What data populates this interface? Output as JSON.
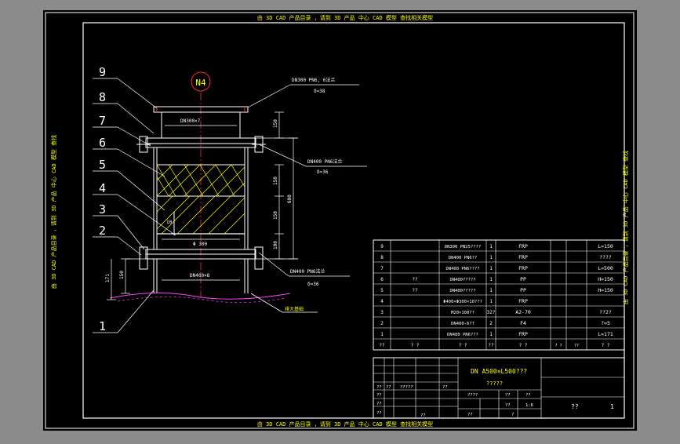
{
  "banners": {
    "top": "由 3D CAD 产品目录 ，请到 3D 产品 中心 CAD 模型 查找相关模型",
    "bottom": "由 3D CAD 产品目录 ，请到 3D 产品 中心 CAD 模型 查找相关模型",
    "left": "由 3D CAD 产品目录 ，请到 3D 产品 中心 CAD 模型 查找",
    "right": "由 3D CAD 产品目录 ，请到 3D 产品 中心 CAD 模型 查找"
  },
  "drawing": {
    "nozzle_tag": "N4",
    "balloons": [
      "9",
      "8",
      "7",
      "6",
      "5",
      "4",
      "3",
      "2",
      "1"
    ],
    "annotations": {
      "top_flange": "DN300 PN6, 6法兰",
      "top_flange_thk": "δ=38",
      "mid_flange": "DN400 PN6法兰",
      "mid_flange_thk": "δ=36",
      "bottom_flange": "DN400 PN6法兰",
      "bottom_flange_thk": "δ=36",
      "spool_dn": "DN300×7",
      "body_dn": "DN400×8",
      "bed_dia": "Φ 300",
      "bed_h": "10",
      "ground": "排大基础"
    },
    "dims": {
      "d150_top": "150",
      "d150_a": "150",
      "d150_b": "150",
      "d100": "100",
      "d600": "600",
      "d150_left": "150",
      "d171": "171"
    }
  },
  "bom": {
    "rows": [
      {
        "no": "9",
        "code": "",
        "name": "DN300 PN25????",
        "qty": "1",
        "mat": "FRP",
        "note": "L=150"
      },
      {
        "no": "8",
        "code": "",
        "name": "DN400 PN6??",
        "qty": "1",
        "mat": "FRP",
        "note": "????"
      },
      {
        "no": "7",
        "code": "",
        "name": "DN400 PN6????",
        "qty": "1",
        "mat": "FRP",
        "note": "L=500"
      },
      {
        "no": "6",
        "code": "??",
        "name": "DN400?????",
        "qty": "1",
        "mat": "PP",
        "note": "H=150"
      },
      {
        "no": "5",
        "code": "??",
        "name": "DN400?????",
        "qty": "1",
        "mat": "PP",
        "note": "H=150"
      },
      {
        "no": "4",
        "code": "",
        "name": "Φ400×Φ300×10???",
        "qty": "1",
        "mat": "FRP",
        "note": ""
      },
      {
        "no": "3",
        "code": "",
        "name": "M20×108??",
        "qty": "32?",
        "mat": "A2-70",
        "note": "??2?"
      },
      {
        "no": "2",
        "code": "",
        "name": "DN400-6??",
        "qty": "2",
        "mat": "F4",
        "note": "?=5"
      },
      {
        "no": "1",
        "code": "",
        "name": "DN480 PN6???",
        "qty": "1",
        "mat": "FRP",
        "note": "L=171"
      }
    ],
    "header": {
      "no": "??",
      "code": "?  ?",
      "name": "?  ?",
      "qty": "??",
      "mat": "?  ?",
      "note": "?  ?",
      "extra1": "? ?",
      "extra2": "??"
    }
  },
  "titleblock": {
    "title1": "DN A500×L500???",
    "title2": "?????",
    "r1": [
      "??",
      "??",
      "?????",
      "??"
    ],
    "r2": [
      "??"
    ],
    "r3": [
      "??"
    ],
    "r4": [
      "??",
      "??"
    ],
    "mid1": [
      "????",
      "??",
      "??"
    ],
    "mid2": [
      "??",
      "1:6"
    ],
    "mid3": [
      "??",
      "?"
    ],
    "sheet": "??",
    "sheet_no": "1"
  },
  "colors": {
    "background": "#8b8b8b",
    "canvas": "#000000",
    "frame": "#ffffff",
    "line_green": "#00ff00",
    "line_cyan": "#00ffff",
    "line_yellow": "#ffff00",
    "line_red": "#ff3030",
    "line_magenta": "#ff40ff"
  }
}
